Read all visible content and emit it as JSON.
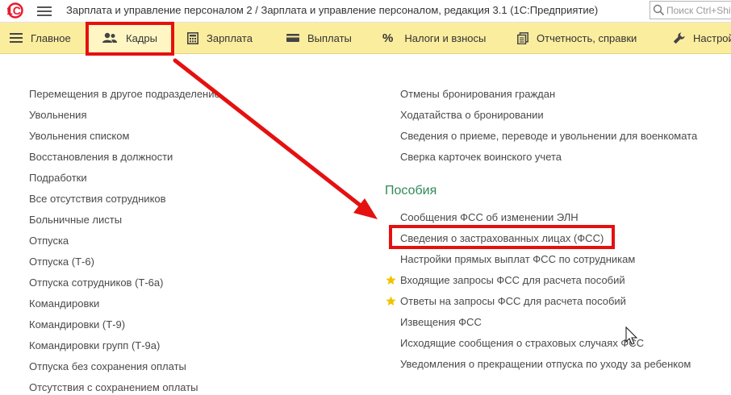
{
  "titlebar": {
    "logo": "1С",
    "title": "Зарплата и управление персоналом 2 / Зарплата и управление персоналом, редакция 3.1  (1С:Предприятие)",
    "search_placeholder": "Поиск Ctrl+Shift+F"
  },
  "sections": [
    {
      "label": "Главное",
      "icon": "hamburger-icon"
    },
    {
      "label": "Кадры",
      "icon": "people-icon"
    },
    {
      "label": "Зарплата",
      "icon": "calculator-icon"
    },
    {
      "label": "Выплаты",
      "icon": "wallet-icon"
    },
    {
      "label": "Налоги и взносы",
      "icon": "percent-icon"
    },
    {
      "label": "Отчетность, справки",
      "icon": "reports-icon"
    },
    {
      "label": "Настройка",
      "icon": "wrench-icon"
    }
  ],
  "active_section": "Кадры",
  "left_links": [
    "Перемещения в другое подразделение",
    "Увольнения",
    "Увольнения списком",
    "Восстановления в должности",
    "Подработки",
    "Все отсутствия сотрудников",
    "Больничные листы",
    "Отпуска",
    "Отпуска (Т-6)",
    "Отпуска сотрудников (Т-6а)",
    "Командировки",
    "Командировки (Т-9)",
    "Командировки групп (Т-9а)",
    "Отпуска без сохранения оплаты",
    "Отсутствия с сохранением оплаты"
  ],
  "right_top_links": [
    "Отмены бронирования граждан",
    "Ходатайства о бронировании",
    "Сведения о приеме, переводе и увольнении для военкомата",
    "Сверка карточек воинского учета"
  ],
  "benefits_group": {
    "heading": "Пособия",
    "links": [
      "Сообщения ФСС об изменении ЭЛН",
      "Сведения о застрахованных лицах (ФСС)",
      "Настройки прямых выплат ФСС по сотрудникам",
      "Входящие запросы ФСС для расчета пособий",
      "Ответы на запросы ФСС для расчета пособий",
      "Извещения ФСС",
      "Исходящие сообщения о страховых случаях ФСС",
      "Уведомления о прекращении отпуска по уходу за ребенком"
    ],
    "starred": [
      false,
      false,
      false,
      true,
      true,
      false,
      false,
      false
    ]
  },
  "colors": {
    "section_bar": "#fbed9e",
    "heading_green": "#2e8b57",
    "annotation_red": "#e51010",
    "star": "#f2c200"
  }
}
